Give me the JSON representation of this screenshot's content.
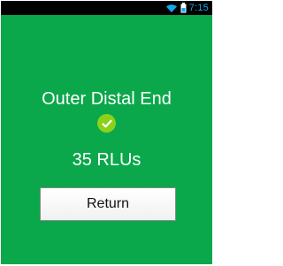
{
  "status_bar": {
    "time": "7:15",
    "icons": [
      "wifi-icon",
      "battery-icon"
    ],
    "time_color": "#18a8e8"
  },
  "result": {
    "location": "Outer Distal End",
    "status_icon": "check-icon",
    "status_color": "#8bd11a",
    "reading": "35 RLUs"
  },
  "actions": {
    "return_label": "Return"
  },
  "colors": {
    "screen_background": "#0aa84a",
    "status_bar_background": "#000000",
    "text": "#ffffff"
  }
}
